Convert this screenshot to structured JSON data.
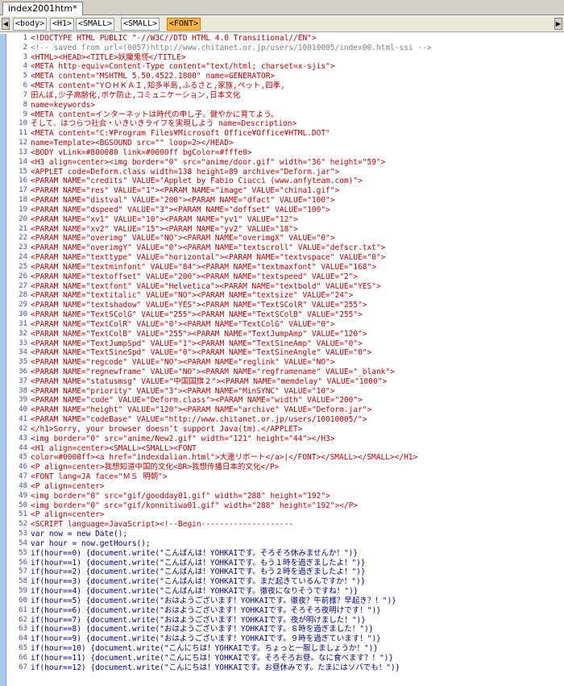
{
  "file_tab": {
    "label": "index2001htm*"
  },
  "tag_crumbs": [
    "<body>",
    "<H1>",
    "<SMALL>",
    "<SMALL>",
    "<FONT>"
  ],
  "active_crumb": 4,
  "colors": {
    "tag": "#c00000",
    "comment": "#808080",
    "script": "#000080",
    "gutter": "#a8c8f0",
    "active_crumb": "#ffb347"
  },
  "icons": {
    "scroll_left": "left-triangle",
    "scroll_right": "right-triangle"
  },
  "lines": [
    {
      "n": "1",
      "t": "<!DOCTYPE HTML PUBLIC \"-//W3C//DTD HTML 4.0 Transitional//EN\">",
      "k": "tag"
    },
    {
      "n": "2",
      "t": "<!-- saved from url=(0057)http://www.chitanet.or.jp/users/10010005/index00.html-ssi -->",
      "k": "comment"
    },
    {
      "n": "3",
      "t": "<HTML><HEAD><TITLE>妖魔鬼怪</TITLE>",
      "k": "tag"
    },
    {
      "n": "4",
      "t": "<META http-equiv=Content-Type content=\"text/html; charset=x-sjis\">",
      "k": "tag"
    },
    {
      "n": "5",
      "t": "<META content=\"MSHTML 5.50.4522.1800\" name=GENERATOR>",
      "k": "tag"
    },
    {
      "n": "6",
      "t": "<META content=\"YＯＨＫＡＩ,知多半島,ふるさと,家族,ペット,四季,",
      "k": "tag"
    },
    {
      "n": "7",
      "t": "田んぼ,少子高齢化,ボケ防止,コミュニケーション,日本文化",
      "k": "jp"
    },
    {
      "n": "8",
      "t": "name=keywords>",
      "k": "tag"
    },
    {
      "n": "9",
      "t": "<META content=インターネットは時代の申し子。健やかに育てよう。",
      "k": "tag"
    },
    {
      "n": "10",
      "t": "そして、はつらつ社会・いきいきライフを実現しよう name=Description>",
      "k": "jp"
    },
    {
      "n": "11",
      "t": "<META content=\"C:¥Program Files¥Microsoft Office¥Office¥HTML.DOT\"",
      "k": "tag"
    },
    {
      "n": "12",
      "t": "name=Template><BGSOUND src=\"\" loop=2></HEAD>",
      "k": "tag"
    },
    {
      "n": "13",
      "t": "<BODY vLink=#800080 link=#0000ff bgColor=#fffe0>",
      "k": "tag"
    },
    {
      "n": "14",
      "t": "<H3 align=center><img border=\"0\" src=\"anime/door.gif\" width=\"36\" height=\"59\">",
      "k": "tag"
    },
    {
      "n": "15",
      "t": "<APPLET code=Deform.class width=138 height=89 archive=\"Deform.jar\">",
      "k": "tag"
    },
    {
      "n": "16",
      "t": "<PARAM NAME=\"credits\" VALUE=\"Applet by Fabio Ciucci (www.anfyteam.com)\">",
      "k": "tag"
    },
    {
      "n": "17",
      "t": "<PARAM NAME=\"res\" VALUE=\"1\"><PARAM NAME=\"image\" VALUE=\"china1.gif\">",
      "k": "tag"
    },
    {
      "n": "18",
      "t": "<PARAM NAME=\"distval\" VALUE=\"200\"><PARAM NAME=\"dfact\" VALUE=\"100\">",
      "k": "tag"
    },
    {
      "n": "19",
      "t": "<PARAM NAME=\"dspeed\" VALUE=\"3\"><PARAM NAME=\"doffset\" VALUE=\"100\">",
      "k": "tag"
    },
    {
      "n": "20",
      "t": "<PARAM NAME=\"xv1\" VALUE=\"10\"><PARAM NAME=\"yv1\" VALUE=\"12\">",
      "k": "tag"
    },
    {
      "n": "21",
      "t": "<PARAM NAME=\"xv2\" VALUE=\"15\"><PARAM NAME=\"yv2\" VALUE=\"18\">",
      "k": "tag"
    },
    {
      "n": "22",
      "t": "<PARAM NAME=\"overimg\" VALUE=\"NO\"><PARAM NAME=\"overimgX\" VALUE=\"0\">",
      "k": "tag"
    },
    {
      "n": "23",
      "t": "<PARAM NAME=\"overimgY\" VALUE=\"0\"><PARAM NAME=\"textscroll\" VALUE=\"defscr.txt\">",
      "k": "tag"
    },
    {
      "n": "24",
      "t": "<PARAM NAME=\"texttype\" VALUE=\"horizontal\"><PARAM NAME=\"textvspace\" VALUE=\"0\">",
      "k": "tag"
    },
    {
      "n": "25",
      "t": "<PARAM NAME=\"textminfont\" VALUE=\"84\"><PARAM NAME=\"textmaxfont\" VALUE=\"168\">",
      "k": "tag"
    },
    {
      "n": "26",
      "t": "<PARAM NAME=\"textoffset\" VALUE=\"200\"><PARAM NAME=\"textspeed\" VALUE=\"2\">",
      "k": "tag"
    },
    {
      "n": "27",
      "t": "<PARAM NAME=\"textfont\" VALUE=\"Helvetica\"><PARAM NAME=\"textbold\" VALUE=\"YES\">",
      "k": "tag"
    },
    {
      "n": "28",
      "t": "<PARAM NAME=\"textitalic\" VALUE=\"NO\"><PARAM NAME=\"textsize\" VALUE=\"24\">",
      "k": "tag"
    },
    {
      "n": "29",
      "t": "<PARAM NAME=\"textshadow\" VALUE=\"YES\"><PARAM NAME=\"TextSColR\" VALUE=\"255\">",
      "k": "tag"
    },
    {
      "n": "30",
      "t": "<PARAM NAME=\"TextSColG\" VALUE=\"255\"><PARAM NAME=\"TextSColB\" VALUE=\"255\">",
      "k": "tag"
    },
    {
      "n": "31",
      "t": "<PARAM NAME=\"TextColR\" VALUE=\"0\"><PARAM NAME=\"TextColG\" VALUE=\"0\">",
      "k": "tag"
    },
    {
      "n": "32",
      "t": "<PARAM NAME=\"TextColB\" VALUE=\"255\"><PARAM NAME=\"TextJumpAmp\" VALUE=\"120\">",
      "k": "tag"
    },
    {
      "n": "33",
      "t": "<PARAM NAME=\"TextJumpSpd\" VALUE=\"1\"><PARAM NAME=\"TextSineAmp\" VALUE=\"0\">",
      "k": "tag"
    },
    {
      "n": "34",
      "t": "<PARAM NAME=\"TextSineSpd\" VALUE=\"0\"><PARAM NAME=\"TextSineAngle\" VALUE=\"0\">",
      "k": "tag"
    },
    {
      "n": "35",
      "t": "<PARAM NAME=\"regcode\" VALUE=\"NO\"><PARAM NAME=\"reglink\" VALUE=\"NO\">",
      "k": "tag"
    },
    {
      "n": "36",
      "t": "<PARAM NAME=\"regnewframe\" VALUE=\"NO\"><PARAM NAME=\"regframename\" VALUE=\"_blank\">",
      "k": "tag"
    },
    {
      "n": "37",
      "t": "<PARAM NAME=\"statusmsg\" VALUE=\"中国国旗２\"><PARAM NAME=\"memdelay\" VALUE=\"1000\">",
      "k": "tag"
    },
    {
      "n": "38",
      "t": "<PARAM NAME=\"priority\" VALUE=\"3\"><PARAM NAME=\"MinSYNC\" VALUE=\"10\">",
      "k": "tag"
    },
    {
      "n": "39",
      "t": "<PARAM NAME=\"code\" VALUE=\"Deform.class\"><PARAM NAME=\"width\" VALUE=\"200\">",
      "k": "tag"
    },
    {
      "n": "40",
      "t": "<PARAM NAME=\"height\" VALUE=\"120\"><PARAM NAME=\"archive\" VALUE=\"Deform.jar\">",
      "k": "tag"
    },
    {
      "n": "41",
      "t": "<PARAM NAME=\"codeBase\" VALUE=\"http://www.chitanet.or.jp/users/10010005/\">",
      "k": "tag"
    },
    {
      "n": "42",
      "t": "</h1>Sorry, your browser doesn't support Java(tm).</APPLET>",
      "k": "tag"
    },
    {
      "n": "43",
      "t": "<img border=\"0\" src=\"anime/New2.gif\" width=\"121\" height=\"44\"></H3>",
      "k": "tag"
    },
    {
      "n": "44",
      "t": "<H1 align=center><SMALL><SMALL><FONT",
      "k": "tag"
    },
    {
      "n": "45",
      "t": "color=#0000ff><a href=\"indexdalian.html\">大連リポート</a>|</FONT></SMALL></SMALL></H1>",
      "k": "tag"
    },
    {
      "n": "46",
      "t": "<P align=center>我想知道中国的文化<BR>我想传播日本的文化</P>",
      "k": "tag"
    },
    {
      "n": "47",
      "t": "<FONT lang=JA face=\"ＭＳ 明朝\">",
      "k": "tag"
    },
    {
      "n": "48",
      "t": "<P align=center>",
      "k": "tag"
    },
    {
      "n": "49",
      "t": "<img border=\"0\" src=\"gif/goodday01.gif\" width=\"288\" height=\"192\">",
      "k": "tag"
    },
    {
      "n": "50",
      "t": "<img border=\"0\" src=\"gif/konnitiwa01.gif\" width=\"288\" height=\"192\"></P>",
      "k": "tag"
    },
    {
      "n": "51",
      "t": "<P align=center>",
      "k": "tag"
    },
    {
      "n": "52",
      "t": "<SCRIPT language=JavaScript><!--Begin--------------------",
      "k": "tag"
    },
    {
      "n": "53",
      "t": "var now = new Date();",
      "k": "script"
    },
    {
      "n": "54",
      "t": "var hour = now.getHours();",
      "k": "script"
    },
    {
      "n": "55",
      "t": "if(hour==0) {document.write(\"こんばんは！YOHKAIです。そろそろ休みませんか！\")}",
      "k": "script"
    },
    {
      "n": "56",
      "t": "if(hour==1) {document.write(\"こんばんは！YOHKAIです。もう１時を過ぎましたよ！\")}",
      "k": "script"
    },
    {
      "n": "57",
      "t": "if(hour==2) {document.write(\"こんばんは！YOHKAIです。もう２時を過ぎましたよ！\")}",
      "k": "script"
    },
    {
      "n": "58",
      "t": "if(hour==3) {document.write(\"こんばんは！YOHKAIです。まだ起きているんですか！\")}",
      "k": "script"
    },
    {
      "n": "59",
      "t": "if(hour==4) {document.write(\"こんばんは！YOHKAIです。徹夜になりそうですね！\")}",
      "k": "script"
    },
    {
      "n": "60",
      "t": "if(hour==5) {document.write(\"おはようございます！YOHKAIです。徹夜？午前様？早起き？！\")}",
      "k": "script"
    },
    {
      "n": "61",
      "t": "if(hour==6) {document.write(\"おはようございます！YOHKAIです。そろそろ夜明けです！\")}",
      "k": "script"
    },
    {
      "n": "62",
      "t": "if(hour==7) {document.write(\"おはようございます！YOHKAIです。夜が明けました！\")}",
      "k": "script"
    },
    {
      "n": "63",
      "t": "if(hour==8) {document.write(\"おはようございます！YOHKAIです。８時を過ぎました！\")}",
      "k": "script"
    },
    {
      "n": "64",
      "t": "if(hour==9) {document.write(\"おはようございます！YOHKAIです。９時を過ぎています！\")}",
      "k": "script"
    },
    {
      "n": "65",
      "t": "if(hour==10) {document.write(\"こんにちは！YOHKAIです。ちょっと一服しましょうか！\")}",
      "k": "script"
    },
    {
      "n": "66",
      "t": "if(hour==11) {document.write(\"こんにちは！YOHKAIです。そろそろお昼。なに食べます？！\")}",
      "k": "script"
    },
    {
      "n": "67",
      "t": "if(hour==12) {document.write(\"こんにちは！YOHKAIです。お昼休みです。たまにはソバでも！\")}",
      "k": "script"
    }
  ]
}
